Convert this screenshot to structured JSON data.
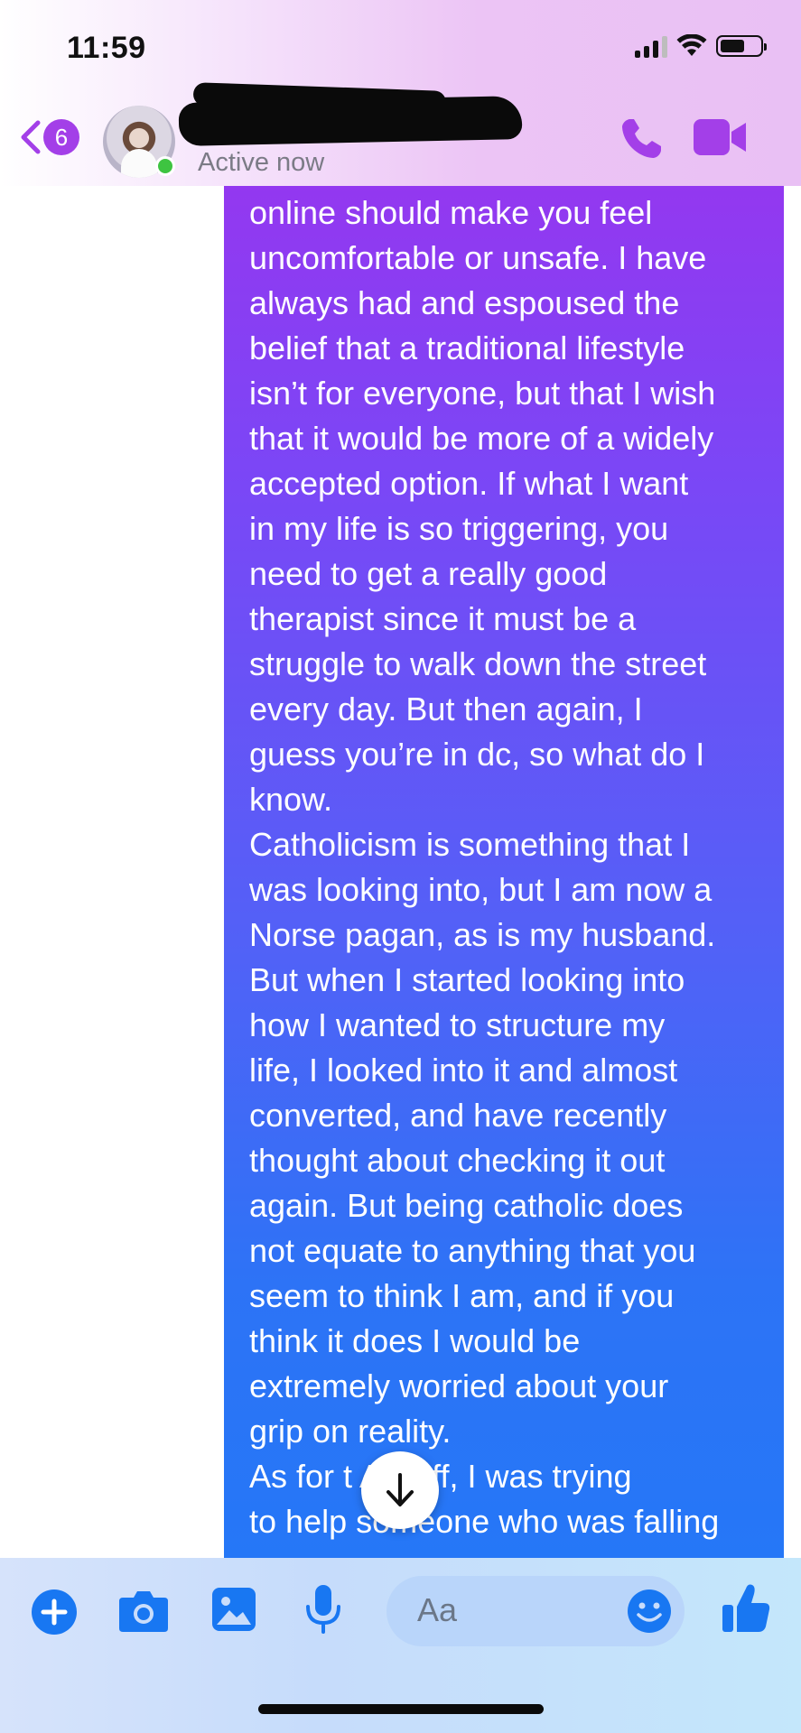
{
  "status_bar": {
    "time": "11:59"
  },
  "header": {
    "unread_count": "6",
    "contact_name_redacted": "",
    "presence": "Active now"
  },
  "message": {
    "text": "online should make you feel\nuncomfortable or unsafe. I have\nalways had and espoused the\nbelief that a traditional lifestyle\nisn’t for everyone, but that I wish\nthat it would be more of a widely\naccepted option. If what I want\nin my life is so triggering, you\nneed to get a really good\ntherapist since it must be a\nstruggle to walk down the street\nevery day. But then again, I\nguess you’re in dc, so what do I\nknow.\nCatholicism is something that I\nwas looking into, but I am now a\nNorse pagan, as is my husband.\nBut when I started looking into\nhow I wanted to structure my\nlife, I looked into it and almost\nconverted, and have recently\nthought about checking it out\nagain. But being catholic does\nnot equate to anything that you\nseem to think I am, and if you\nthink it does I would be\nextremely worried about your\ngrip on reality.\nAs for t     A stuff, I was trying\nto help someone who was falling"
  },
  "composer": {
    "placeholder": "Aa"
  },
  "icons": {
    "back": "chevron-left-icon",
    "call": "phone-icon",
    "video": "video-camera-icon",
    "add": "plus-circle-icon",
    "camera": "camera-icon",
    "gallery": "image-icon",
    "mic": "microphone-icon",
    "emoji": "smiley-icon",
    "like": "thumbs-up-icon",
    "scroll": "arrow-down-icon"
  },
  "colors": {
    "accent_purple": "#a33fe8",
    "accent_blue": "#1877f2",
    "online_green": "#3ec441"
  }
}
